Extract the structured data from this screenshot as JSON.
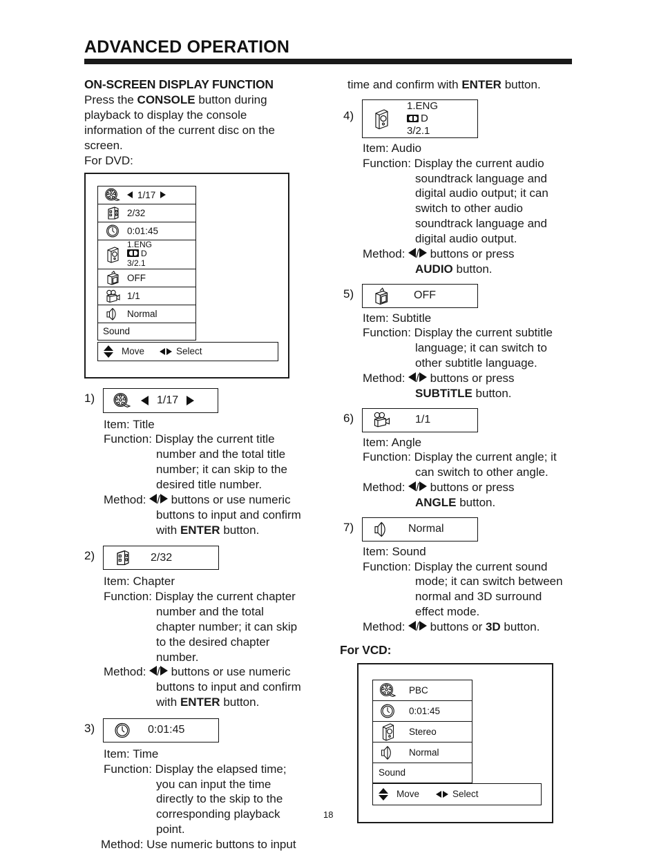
{
  "header": {
    "chapter_title": "ADVANCED OPERATION"
  },
  "page_number": "18",
  "left_column": {
    "section_heading": "ON-SCREEN DISPLAY FUNCTION",
    "intro": {
      "line1_pre": "Press the ",
      "line1_bold": "CONSOLE",
      "line1_post": " button during",
      "line2": "playback to display the console",
      "line3": "information of the current disc on the",
      "line4": "screen.",
      "line5": "For DVD:"
    },
    "dvd_osd": {
      "rows": [
        {
          "icon": "film-reel-icon",
          "value": "1/17",
          "has_arrows": true
        },
        {
          "icon": "film-strip-icon",
          "value": "2/32",
          "has_arrows": false
        },
        {
          "icon": "clock-icon",
          "value": "0:01:45",
          "has_arrows": false
        },
        {
          "icon": "audio-box-icon",
          "value": "1.ENG",
          "value2": "D",
          "value3": "3/2.1",
          "has_dolby": true,
          "has_arrows": false
        },
        {
          "icon": "tv-icon",
          "value": "OFF",
          "has_arrows": false
        },
        {
          "icon": "movie-camera-icon",
          "value": "1/1",
          "has_arrows": false
        },
        {
          "icon": "speaker-icon",
          "value": "Normal",
          "has_arrows": false
        },
        {
          "icon": "none",
          "value": "Sound",
          "has_arrows": false
        }
      ],
      "footer": {
        "move_label": "Move",
        "select_label": "Select"
      }
    },
    "items": [
      {
        "number": "1)",
        "icon": "film-reel-icon",
        "sample_value": "1/17",
        "has_arrows": true,
        "item_label": "Item:",
        "item_name": "Title",
        "function_label": "Function:",
        "function_lines": [
          "Display the current title",
          "number and the total title",
          "number; it can skip to the",
          "desired title number."
        ],
        "method_label": "Method:",
        "method_lines": [
          "buttons or use numeric",
          "buttons to input and confirm",
          "with ENTER button."
        ],
        "method_bold": "ENTER"
      },
      {
        "number": "2)",
        "icon": "film-strip-icon",
        "sample_value": "2/32",
        "has_arrows": false,
        "item_label": "Item:",
        "item_name": "Chapter",
        "function_label": "Function:",
        "function_lines": [
          "Display the current chapter",
          "number and the total",
          "chapter number; it can skip",
          "to the desired chapter",
          "number."
        ],
        "method_label": "Method:",
        "method_lines": [
          "buttons or use numeric",
          "buttons to input and confirm",
          "with ENTER button."
        ],
        "method_bold": "ENTER"
      },
      {
        "number": "3)",
        "icon": "clock-icon",
        "sample_value": "0:01:45",
        "has_arrows": false,
        "item_label": "Item:",
        "item_name": "Time",
        "function_label": "Function:",
        "function_lines": [
          "Display the elapsed time;",
          "you can input the time",
          "directly to the skip to the",
          "corresponding playback",
          "point."
        ],
        "method_label": "Method:",
        "method_lines": [
          "Use numeric buttons to input"
        ],
        "method_no_arrows": true
      }
    ]
  },
  "right_column": {
    "continuation": {
      "pre": "time and confirm with ",
      "bold": "ENTER",
      "post": " button."
    },
    "items": [
      {
        "number": "4)",
        "icon": "audio-box-icon",
        "sample_value": "1.ENG",
        "sample_value2": "D",
        "sample_value3": "3/2.1",
        "has_dolby": true,
        "item_label": "Item:",
        "item_name": "Audio",
        "function_label": "Function:",
        "function_lines": [
          "Display the current audio",
          "soundtrack language and",
          "digital audio output; it can",
          "switch to other audio",
          "soundtrack language and",
          "digital audio output."
        ],
        "method_label": "Method:",
        "method_lines": [
          "buttons or press",
          "AUDIO button."
        ],
        "method_bold": "AUDIO"
      },
      {
        "number": "5)",
        "icon": "tv-icon",
        "sample_value": "OFF",
        "item_label": "Item:",
        "item_name": "Subtitle",
        "function_label": "Function:",
        "function_lines": [
          "Display the current subtitle",
          "language; it can switch to",
          "other subtitle language."
        ],
        "method_label": "Method:",
        "method_lines": [
          "buttons or press",
          "SUBTiTLE button."
        ],
        "method_bold": "SUBTiTLE"
      },
      {
        "number": "6)",
        "icon": "movie-camera-icon",
        "sample_value": "1/1",
        "item_label": "Item:",
        "item_name": "Angle",
        "function_label": "Function:",
        "function_lines": [
          "Display the current angle; it",
          "can switch to other angle."
        ],
        "method_label": "Method:",
        "method_lines": [
          "buttons or press",
          "ANGLE button."
        ],
        "method_bold": "ANGLE"
      },
      {
        "number": "7)",
        "icon": "speaker-icon",
        "sample_value": "Normal",
        "item_label": "Item:",
        "item_name": "Sound",
        "function_label": "Function:",
        "function_lines": [
          "Display the current sound",
          "mode; it can switch between",
          "normal and 3D surround",
          "effect mode."
        ],
        "method_label": "Method:",
        "method_lines": [
          "buttons or 3D button."
        ],
        "method_bold": "3D"
      }
    ],
    "vcd_heading": "For VCD:",
    "vcd_osd": {
      "rows": [
        {
          "icon": "film-reel-icon",
          "value": "PBC"
        },
        {
          "icon": "clock-icon",
          "value": "0:01:45"
        },
        {
          "icon": "audio-box-icon",
          "value": "Stereo"
        },
        {
          "icon": "speaker-icon",
          "value": "Normal"
        },
        {
          "icon": "none",
          "value": "Sound"
        }
      ],
      "footer": {
        "move_label": "Move",
        "select_label": "Select"
      }
    }
  }
}
